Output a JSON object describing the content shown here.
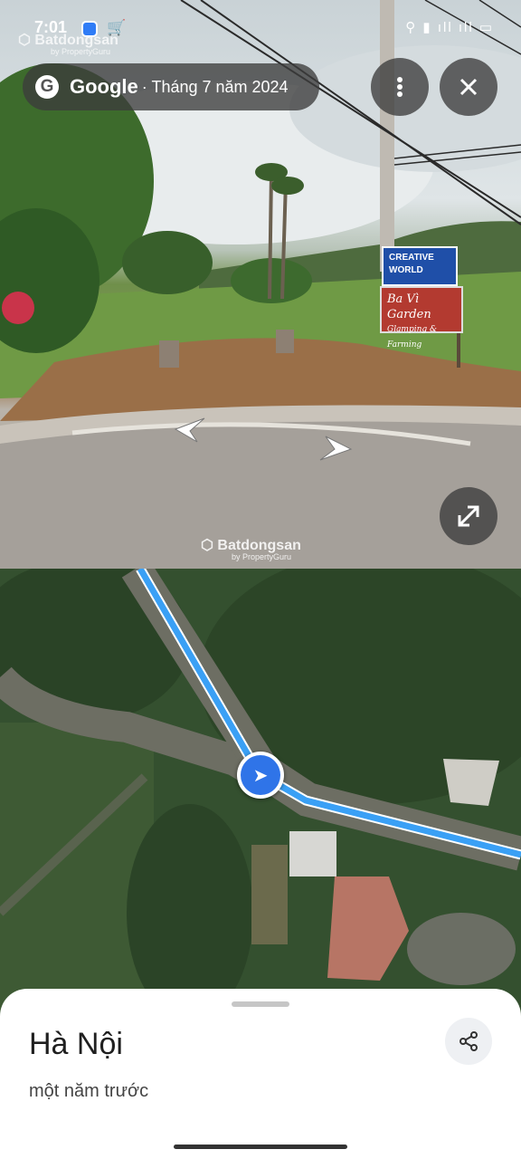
{
  "status_bar": {
    "time": "7:01",
    "right_text": "⚲ ▮ ıll ıll ▭"
  },
  "street_view": {
    "brand": "Google",
    "date": "· Tháng 7 năm 2024",
    "more_icon": "more-vert-icon",
    "close_icon": "close-icon",
    "expand_icon": "expand-icon",
    "watermark_top": "Batdongsan",
    "watermark_top_sub": "by PropertyGuru",
    "watermark_mid": "Batdongsan",
    "watermark_mid_sub": "by PropertyGuru",
    "sign_blue_line1": "CREATIVE",
    "sign_blue_line2": "WORLD",
    "sign_red_line1": "Ba Vì Garden",
    "sign_red_line2": "Glamping & Farming"
  },
  "map": {
    "marker_icon": "navigation-arrow-icon",
    "route_color": "#3aa0f5"
  },
  "sheet": {
    "title": "Hà Nội",
    "subtitle": "một năm trước",
    "share_icon": "share-icon"
  }
}
